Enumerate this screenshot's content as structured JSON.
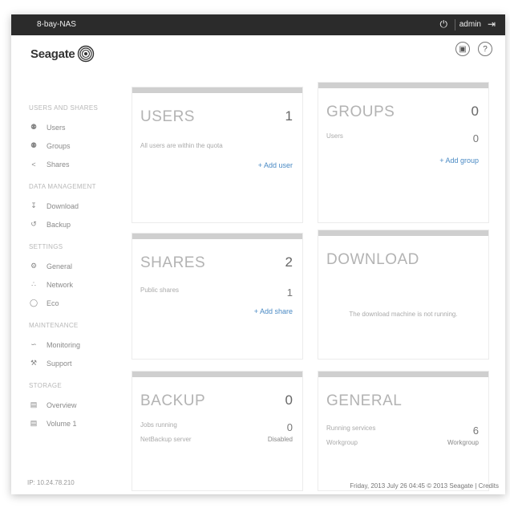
{
  "topbar": {
    "device_name": "8-bay-NAS",
    "user": "admin"
  },
  "logo": {
    "text": "Seagate"
  },
  "sidebar": {
    "sections": [
      {
        "title": "USERS AND SHARES",
        "items": [
          {
            "label": "Users",
            "icon": "user-icon"
          },
          {
            "label": "Groups",
            "icon": "group-icon"
          },
          {
            "label": "Shares",
            "icon": "share-icon"
          }
        ]
      },
      {
        "title": "DATA MANAGEMENT",
        "items": [
          {
            "label": "Download",
            "icon": "download-icon"
          },
          {
            "label": "Backup",
            "icon": "backup-icon"
          }
        ]
      },
      {
        "title": "SETTINGS",
        "items": [
          {
            "label": "General",
            "icon": "gear-icon"
          },
          {
            "label": "Network",
            "icon": "network-icon"
          },
          {
            "label": "Eco",
            "icon": "eco-icon"
          }
        ]
      },
      {
        "title": "MAINTENANCE",
        "items": [
          {
            "label": "Monitoring",
            "icon": "monitoring-icon"
          },
          {
            "label": "Support",
            "icon": "wrench-icon"
          }
        ]
      },
      {
        "title": "STORAGE",
        "items": [
          {
            "label": "Overview",
            "icon": "storage-icon"
          },
          {
            "label": "Volume 1",
            "icon": "storage-icon"
          }
        ]
      }
    ]
  },
  "panels": {
    "users": {
      "title": "USERS",
      "count": "1",
      "row1_label": "All users are within the quota",
      "link": "+ Add user"
    },
    "groups": {
      "title": "GROUPS",
      "count": "0",
      "row1_label": "Users",
      "row1_value": "0",
      "link": "+ Add group"
    },
    "shares": {
      "title": "SHARES",
      "count": "2",
      "row1_label": "Public shares",
      "row1_value": "1",
      "link": "+ Add share"
    },
    "download": {
      "title": "DOWNLOAD",
      "message": "The download machine is not running."
    },
    "backup": {
      "title": "BACKUP",
      "count": "0",
      "row1_label": "Jobs running",
      "row1_value": "0",
      "row2_label": "NetBackup server",
      "row2_value": "Disabled"
    },
    "general": {
      "title": "GENERAL",
      "row1_label": "Running services",
      "row1_value": "6",
      "row2_label": "Workgroup",
      "row2_value": "Workgroup"
    }
  },
  "status": {
    "ip": "IP: 10.24.78.210",
    "footer": "Friday, 2013 July 26  04:45  © 2013 Seagate | Credits"
  },
  "colors": {
    "topbar": "#2b2b2b",
    "link": "#4a8ac4",
    "panel_bar": "#cfcfcf"
  }
}
